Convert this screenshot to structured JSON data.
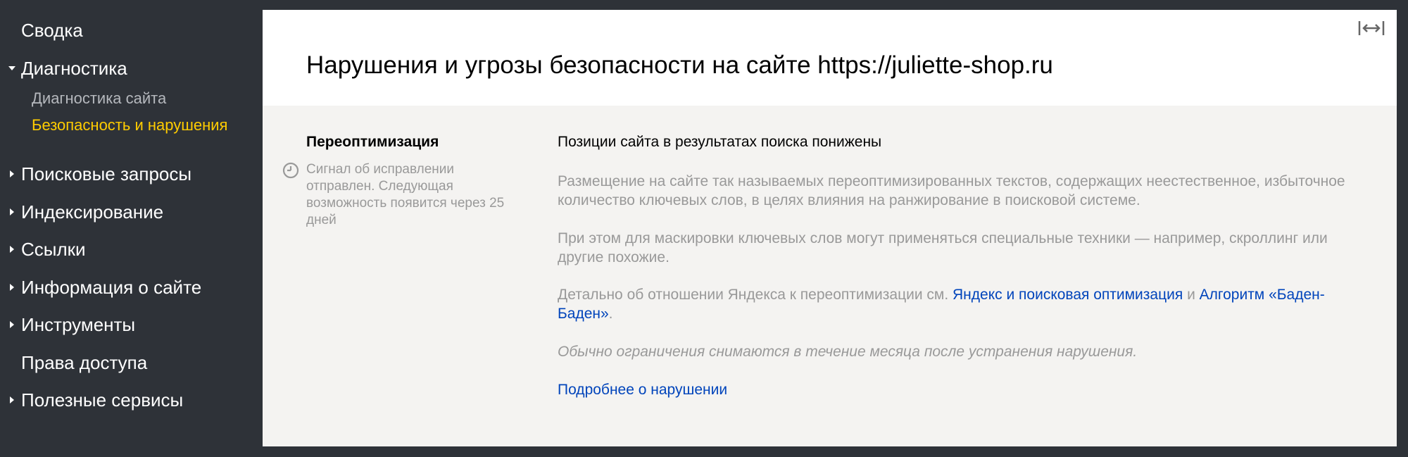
{
  "sidebar": {
    "items": [
      {
        "label": "Сводка"
      },
      {
        "label": "Диагностика"
      },
      {
        "label": "Диагностика сайта"
      },
      {
        "label": "Безопасность и нарушения"
      },
      {
        "label": "Поисковые запросы"
      },
      {
        "label": "Индексирование"
      },
      {
        "label": "Ссылки"
      },
      {
        "label": "Информация о сайте"
      },
      {
        "label": "Инструменты"
      },
      {
        "label": "Права доступа"
      },
      {
        "label": "Полезные сервисы"
      }
    ]
  },
  "header": {
    "title": "Нарушения и угрозы безопасности на сайте https://juliette-shop.ru",
    "expand_icon": "expand-horizontal-icon"
  },
  "issue": {
    "title": "Переоптимизация",
    "status_icon": "clock-icon",
    "status_text": "Сигнал об исправлении отправлен. Следующая возможность появится через 25 дней",
    "headline": "Позиции сайта в результатах поиска понижены",
    "paragraph1": "Размещение на сайте так называемых переоптимизированных текстов, содержащих неестественное, избыточное количество ключевых слов, в целях влияния на ранжирование в поисковой системе.",
    "paragraph2": "При этом для маскировки ключевых слов могут применяться специальные техники — например, скроллинг или другие похожие.",
    "paragraph3_prefix": "Детально об отношении Яндекса к переоптимизации см. ",
    "link1": "Яндекс и поисковая оптимизация",
    "paragraph3_and": " и ",
    "link2": "Алгоритм «Баден-Баден»",
    "paragraph3_suffix": ".",
    "paragraph4": "Обычно ограничения снимаются в течение месяца после устранения нарушения.",
    "more_link": "Подробнее о нарушении"
  },
  "colors": {
    "sidebar_bg": "#2e3238",
    "active": "#ffcc00",
    "link": "#0044bb",
    "panel_bg": "#f4f3f1",
    "muted_text": "#999999"
  }
}
